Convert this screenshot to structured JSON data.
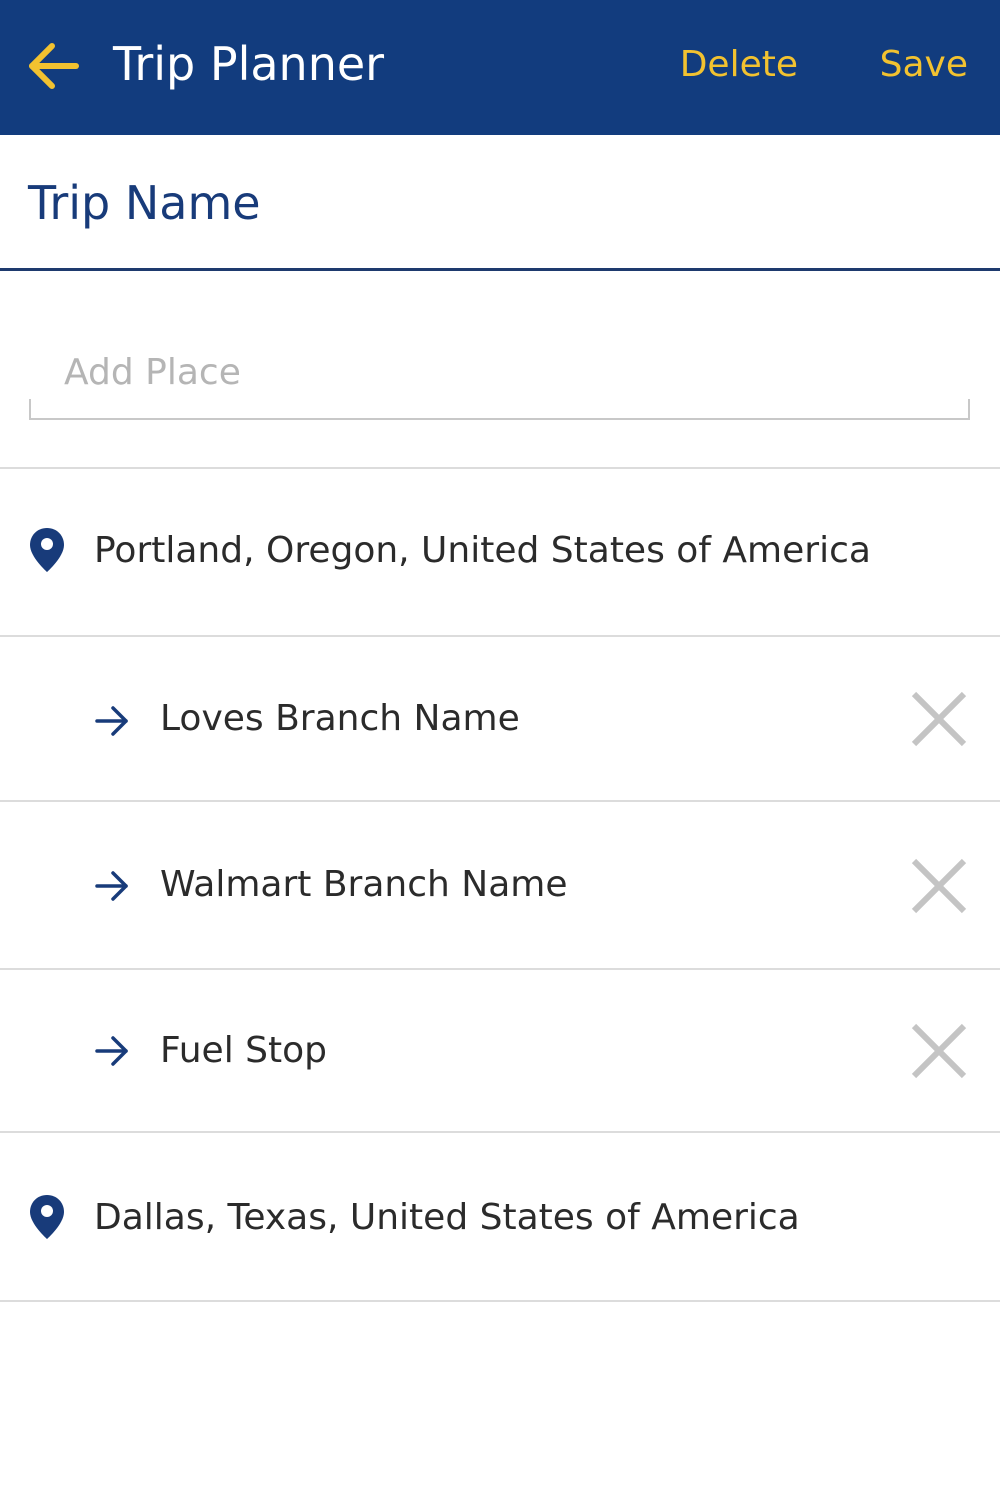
{
  "header": {
    "title": "Trip Planner",
    "delete_label": "Delete",
    "save_label": "Save",
    "back_icon": "arrow-left-icon"
  },
  "trip": {
    "name": "Trip Name"
  },
  "add_place": {
    "placeholder": "Add Place",
    "value": ""
  },
  "origin": {
    "icon": "map-pin-icon",
    "label": "Portland, Oregon, United States of America"
  },
  "stops": [
    {
      "label": "Loves Branch Name",
      "icon": "arrow-right-icon",
      "remove_icon": "close-icon"
    },
    {
      "label": "Walmart Branch Name",
      "icon": "arrow-right-icon",
      "remove_icon": "close-icon"
    },
    {
      "label": "Fuel Stop",
      "icon": "arrow-right-icon",
      "remove_icon": "close-icon"
    }
  ],
  "destination": {
    "icon": "map-pin-icon",
    "label": "Dallas, Texas, United States of America"
  },
  "colors": {
    "header_bg": "#123c7e",
    "accent": "#f2c230",
    "brand_blue": "#183b7a",
    "divider": "#dcdcdc",
    "close_gray": "#c4c4c4"
  }
}
